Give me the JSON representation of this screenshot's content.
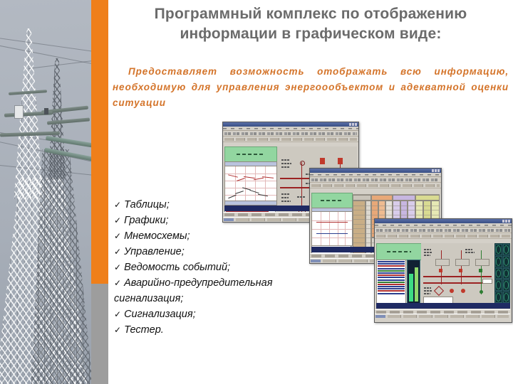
{
  "slide": {
    "title_lines": [
      "Программный комплекс по отображению",
      "информации в графическом виде:"
    ],
    "subtitle_lines": [
      "Предоставляет возможность отображать всю информацию,",
      "необходимую для управления энергоообъектом и адекватной",
      "оценки ситуации"
    ],
    "bullet_marker": "✓",
    "bullets": [
      {
        "text": "Таблицы;"
      },
      {
        "text": "Графики;"
      },
      {
        "text": "Мнемосхемы;"
      },
      {
        "text": "Управление;"
      },
      {
        "text": "Ведомость событий;"
      },
      {
        "text": "Аварийно-предупредительная",
        "cont": "сигнализация;"
      },
      {
        "text": "Сигнализация;"
      },
      {
        "text": "Тестер."
      }
    ],
    "colors": {
      "accent_orange": "#ef7f1a",
      "title_grey": "#6b6b6b",
      "subtitle_orange": "#d4742a",
      "sidebar_grey": "#9d9d9d",
      "window_face": "#d4d0c8",
      "titlebar_blue": "#3a4f84",
      "green_panel": "#92d6a0",
      "mimic_red": "#9b2222",
      "gauge_teal": "#13383c"
    },
    "photo": {
      "subject": "high-voltage transmission towers",
      "sky": "#a9b0b9"
    },
    "screenshots": [
      {
        "name": "window-mimic-and-trends",
        "contents": [
          "toolbar",
          "green-header-panel",
          "trend-chart",
          "data-table",
          "single-line-diagram",
          "navy-status-bar",
          "taskbar"
        ]
      },
      {
        "name": "window-colored-table",
        "contents": [
          "toolbar",
          "green-header-panel",
          "trend-chart",
          "colored-measurement-table",
          "navy-status-bar",
          "taskbar"
        ],
        "table_group_colors": [
          "#c9ae86",
          "#e8a878",
          "#c7b6e0",
          "#d9db92"
        ]
      },
      {
        "name": "window-alarms-and-gauges",
        "contents": [
          "toolbar",
          "green-header-panel",
          "event-log",
          "bar-meters",
          "single-line-diagram",
          "gauge-grid",
          "navy-status-bar",
          "taskbar"
        ]
      }
    ]
  }
}
